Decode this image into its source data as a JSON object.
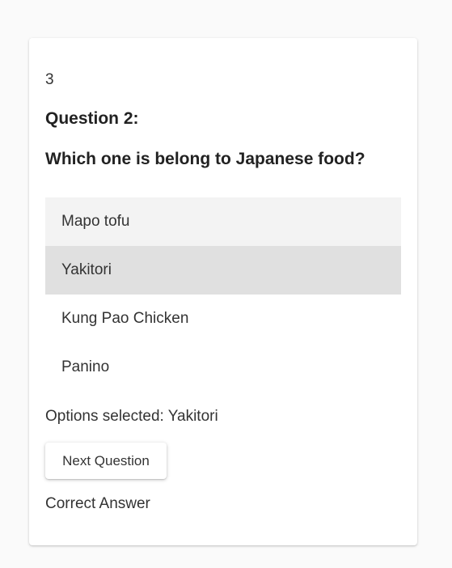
{
  "quiz": {
    "counter": "3",
    "question_number": "Question 2:",
    "question_text": "Which one is belong to Japanese food?",
    "options": [
      {
        "label": "Mapo tofu",
        "state": "hovered"
      },
      {
        "label": "Yakitori",
        "state": "selected"
      },
      {
        "label": "Kung Pao Chicken",
        "state": "normal"
      },
      {
        "label": "Panino",
        "state": "normal"
      }
    ],
    "selected_text": "Options selected: Yakitori",
    "next_button_label": "Next Question",
    "result_text": "Correct Answer"
  },
  "colors": {
    "page_background": "#fafafa",
    "card_background": "#ffffff",
    "option_hover": "#f3f3f3",
    "option_selected": "#e0e0e0",
    "text": "#333333"
  }
}
